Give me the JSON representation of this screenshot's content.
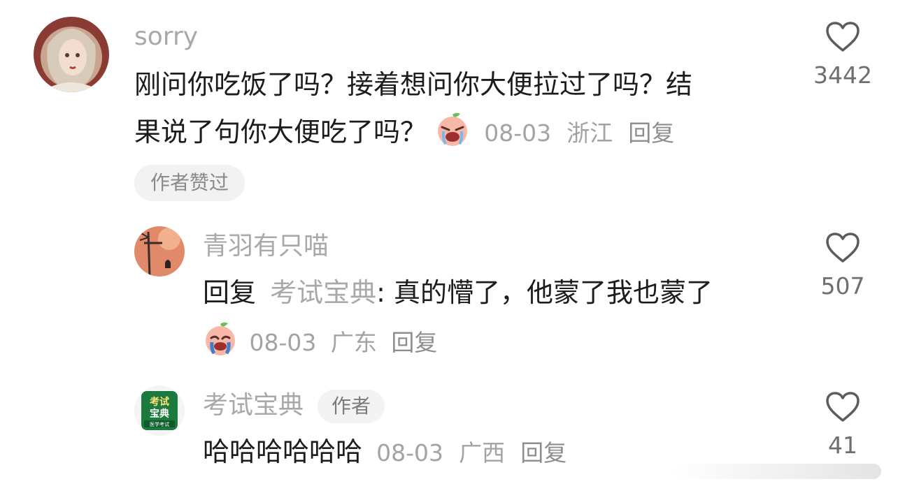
{
  "comments": [
    {
      "username": "sorry",
      "text_line1": "刚问你吃饭了吗？接着想问你大便拉过了吗？结",
      "text_line2": "果说了句你大便吃了吗？",
      "emoji": "crying-peach-emoji",
      "date": "08-03",
      "location": "浙江",
      "reply_label": "回复",
      "badge": "作者赞过",
      "like_count": "3442"
    }
  ],
  "replies": [
    {
      "username": "青羽有只喵",
      "reply_prefix": "回复",
      "reply_target": "考试宝典",
      "text": ": 真的懵了，他蒙了我也蒙了",
      "emoji": "crying-peach-emoji",
      "date": "08-03",
      "location": "广东",
      "reply_label": "回复",
      "like_count": "507"
    },
    {
      "username": "考试宝典",
      "author_tag": "作者",
      "text": "哈哈哈哈哈哈",
      "date": "08-03",
      "location": "广西",
      "reply_label": "回复",
      "like_count": "41",
      "avatar_text_top": "考试",
      "avatar_text_bottom": "宝典",
      "avatar_caption": "医学考试"
    }
  ],
  "icons": {
    "like": "heart-outline-icon"
  },
  "colors": {
    "username": "#a9a9a9",
    "meta": "#a3a3a3",
    "text": "#1c1c1c",
    "badge_bg": "#f2f2f2"
  }
}
